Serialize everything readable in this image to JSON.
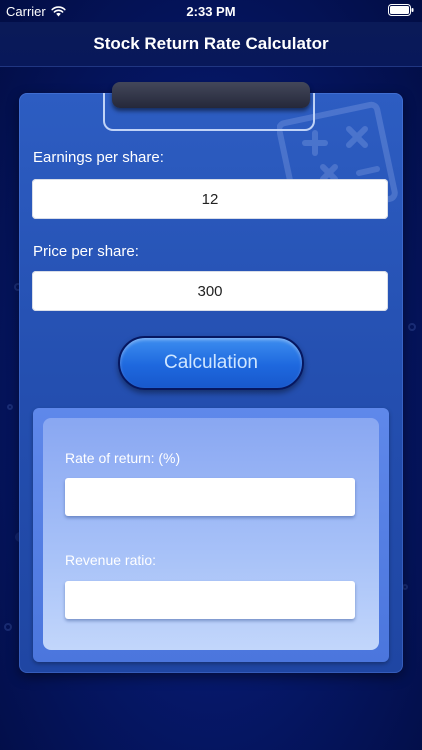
{
  "status_bar": {
    "carrier": "Carrier",
    "time": "2:33 PM",
    "wifi_icon": "wifi-icon",
    "battery_icon": "battery-icon"
  },
  "nav": {
    "title": "Stock Return Rate Calculator"
  },
  "form": {
    "eps_label": "Earnings per share:",
    "eps_value": "12",
    "price_label": "Price per share:",
    "price_value": "300",
    "calculate_label": "Calculation"
  },
  "results": {
    "rate_label": "Rate of return: (%)",
    "rate_value": "",
    "ratio_label": "Revenue ratio:",
    "ratio_value": ""
  },
  "colors": {
    "background": "#06186a",
    "clipboard": "#2d5dc2",
    "button": "#1e68de",
    "results_panel": "#a8c2f8"
  }
}
